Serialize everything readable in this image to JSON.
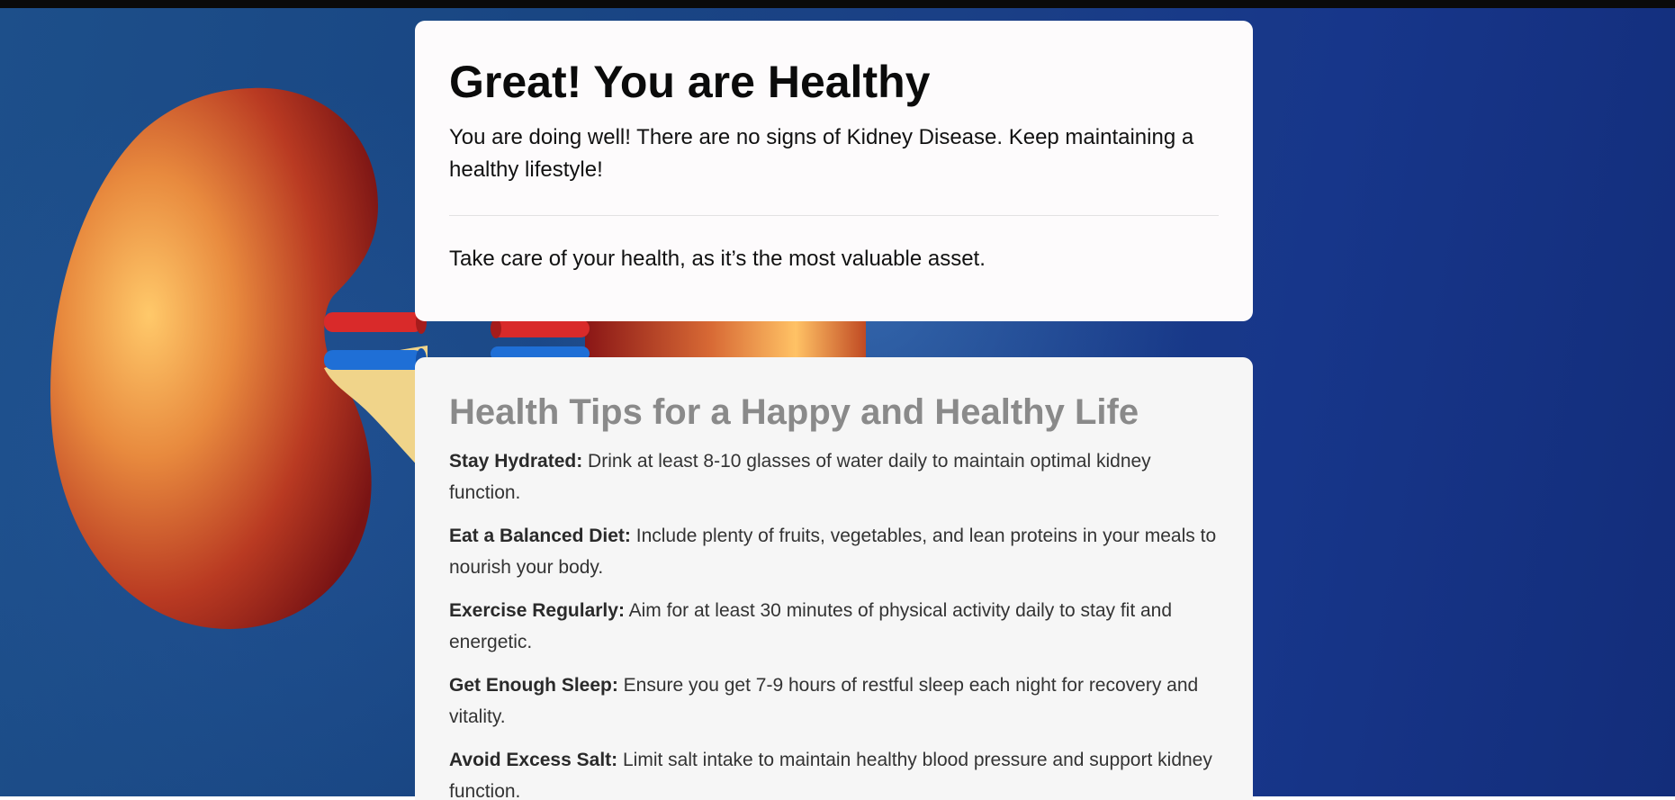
{
  "result": {
    "title": "Great! You are Healthy",
    "message": "You are doing well! There are no signs of Kidney Disease. Keep maintaining a healthy lifestyle!",
    "quote": "Take care of your health, as it’s the most valuable asset."
  },
  "tips": {
    "title": "Health Tips for a Happy and Healthy Life",
    "items": [
      {
        "label": "Stay Hydrated:",
        "text": " Drink at least 8-10 glasses of water daily to maintain optimal kidney function."
      },
      {
        "label": "Eat a Balanced Diet:",
        "text": " Include plenty of fruits, vegetables, and lean proteins in your meals to nourish your body."
      },
      {
        "label": "Exercise Regularly:",
        "text": " Aim for at least 30 minutes of physical activity daily to stay fit and energetic."
      },
      {
        "label": "Get Enough Sleep:",
        "text": " Ensure you get 7-9 hours of restful sleep each night for recovery and vitality."
      },
      {
        "label": "Avoid Excess Salt:",
        "text": " Limit salt intake to maintain healthy blood pressure and support kidney function."
      }
    ]
  },
  "background": {
    "image": "kidney-illustration",
    "colors": {
      "blue": "#1a4586",
      "kidney": "#b8381f",
      "artery": "#d92a2a",
      "vein": "#1f6fd6",
      "ureter": "#f0d48a"
    }
  }
}
